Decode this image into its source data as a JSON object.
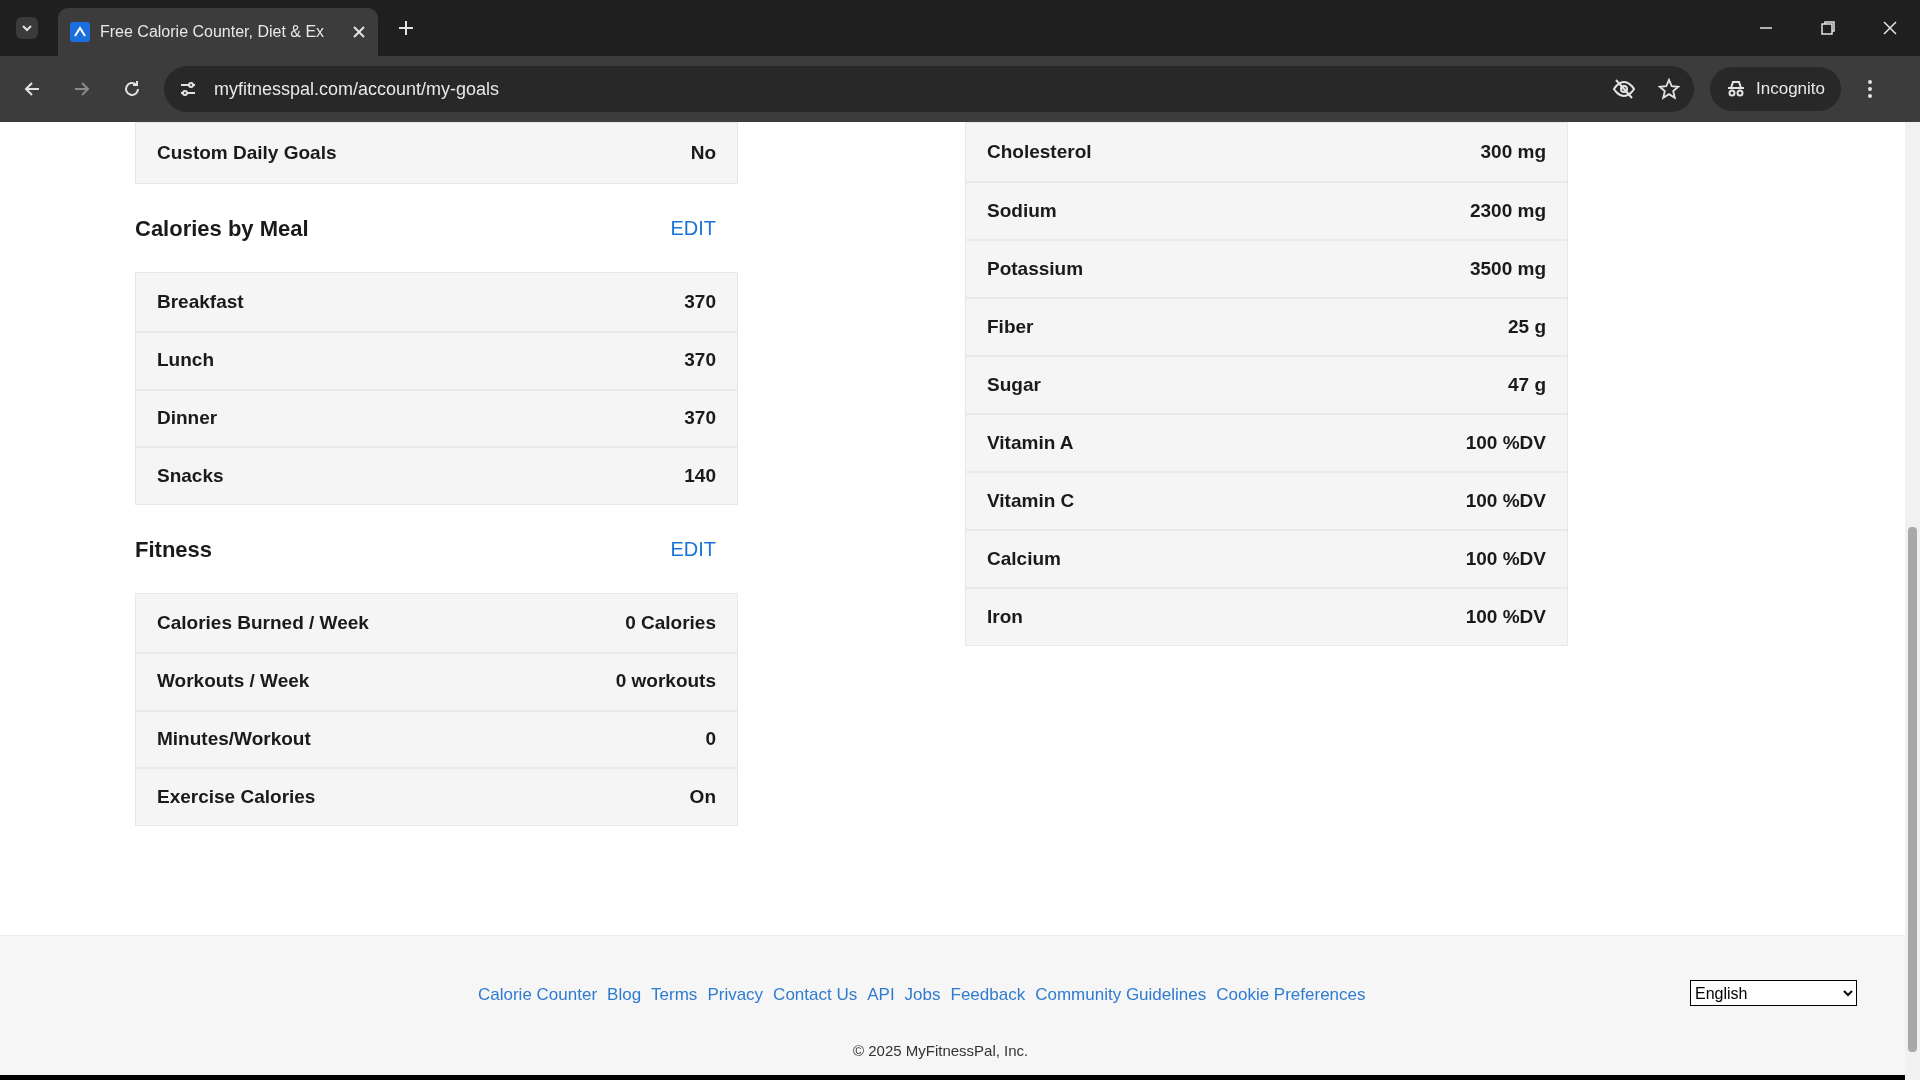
{
  "browser": {
    "tab_title": "Free Calorie Counter, Diet & Ex",
    "url": "myfitnesspal.com/account/my-goals",
    "profile_label": "Incognito"
  },
  "left_sections": [
    {
      "rows": [
        {
          "label": "Custom Daily Goals",
          "value": "No"
        }
      ]
    },
    {
      "title": "Calories by Meal",
      "action": "EDIT",
      "rows": [
        {
          "label": "Breakfast",
          "value": "370"
        },
        {
          "label": "Lunch",
          "value": "370"
        },
        {
          "label": "Dinner",
          "value": "370"
        },
        {
          "label": "Snacks",
          "value": "140"
        }
      ]
    },
    {
      "title": "Fitness",
      "action": "EDIT",
      "rows": [
        {
          "label": "Calories Burned / Week",
          "value": "0 Calories"
        },
        {
          "label": "Workouts / Week",
          "value": "0 workouts"
        },
        {
          "label": "Minutes/Workout",
          "value": "0"
        },
        {
          "label": "Exercise Calories",
          "value": "On"
        }
      ]
    }
  ],
  "right_rows": [
    {
      "label": "Cholesterol",
      "value": "300 mg"
    },
    {
      "label": "Sodium",
      "value": "2300 mg"
    },
    {
      "label": "Potassium",
      "value": "3500 mg"
    },
    {
      "label": "Fiber",
      "value": "25 g"
    },
    {
      "label": "Sugar",
      "value": "47 g"
    },
    {
      "label": "Vitamin A",
      "value": "100 %DV"
    },
    {
      "label": "Vitamin C",
      "value": "100 %DV"
    },
    {
      "label": "Calcium",
      "value": "100 %DV"
    },
    {
      "label": "Iron",
      "value": "100 %DV"
    }
  ],
  "footer": {
    "links": [
      "Calorie Counter",
      "Blog",
      "Terms",
      "Privacy",
      "Contact Us",
      "API",
      "Jobs",
      "Feedback",
      "Community Guidelines",
      "Cookie Preferences"
    ],
    "language": "English",
    "copyright": "© 2025 MyFitnessPal, Inc."
  }
}
